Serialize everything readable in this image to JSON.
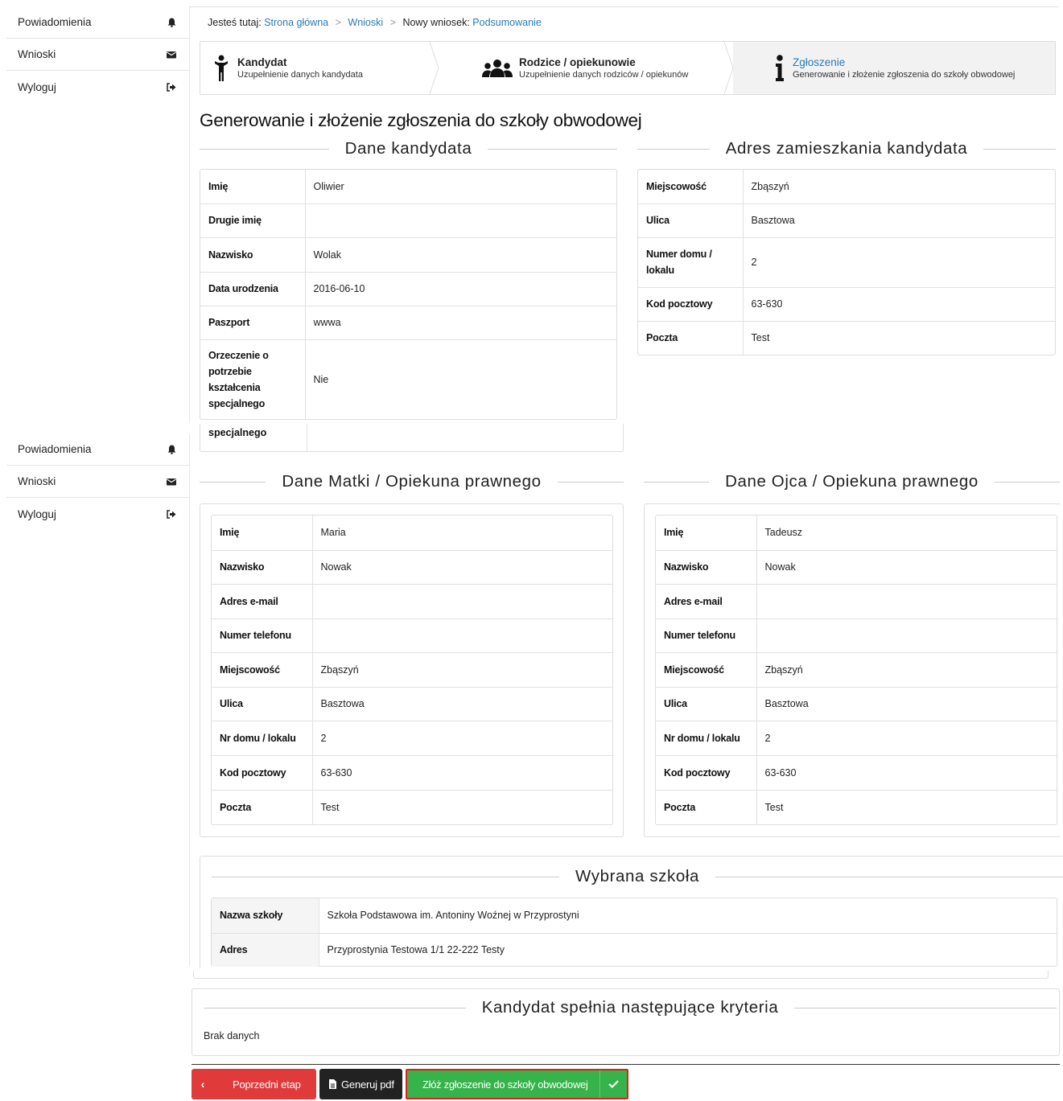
{
  "sidebar": {
    "items": [
      {
        "label": "Powiadomienia",
        "icon": "bell-icon"
      },
      {
        "label": "Wnioski",
        "icon": "envelope-icon"
      },
      {
        "label": "Wyloguj",
        "icon": "sign-out-icon"
      }
    ]
  },
  "breadcrumb": {
    "prefix": "Jesteś tutaj:",
    "home": "Strona główna",
    "section": "Wnioski",
    "current_prefix": "Nowy wniosek:",
    "current": "Podsumowanie"
  },
  "steps": [
    {
      "title": "Kandydat",
      "subtitle": "Uzupełnienie danych kandydata",
      "icon": "child-icon"
    },
    {
      "title": "Rodzice / opiekunowie",
      "subtitle": "Uzupełnienie danych rodziców / opiekunów",
      "icon": "users-icon"
    },
    {
      "title": "Zgłoszenie",
      "subtitle": "Generowanie i złożenie zgłoszenia do szkoły obwodowej",
      "icon": "info-icon"
    }
  ],
  "page_title": "Generowanie i złożenie zgłoszenia do szkoły obwodowej",
  "candidate": {
    "title": "Dane kandydata",
    "rows": [
      {
        "label": "Imię",
        "value": "Oliwier"
      },
      {
        "label": "Drugie imię",
        "value": ""
      },
      {
        "label": "Nazwisko",
        "value": "Wolak"
      },
      {
        "label": "Data urodzenia",
        "value": "2016-06-10"
      },
      {
        "label": "Paszport",
        "value": "wwwa"
      },
      {
        "label": "Orzeczenie o potrzebie kształcenia specjalnego",
        "value": "Nie"
      }
    ],
    "overflow_label": "specjalnego"
  },
  "address": {
    "title": "Adres zamieszkania kandydata",
    "rows": [
      {
        "label": "Miejscowość",
        "value": "Zbąszyń"
      },
      {
        "label": "Ulica",
        "value": "Basztowa"
      },
      {
        "label": "Numer domu / lokalu",
        "value": "2"
      },
      {
        "label": "Kod pocztowy",
        "value": "63-630"
      },
      {
        "label": "Poczta",
        "value": "Test"
      }
    ]
  },
  "mother": {
    "title": "Dane Matki / Opiekuna prawnego",
    "rows": [
      {
        "label": "Imię",
        "value": "Maria"
      },
      {
        "label": "Nazwisko",
        "value": "Nowak"
      },
      {
        "label": "Adres e-mail",
        "value": ""
      },
      {
        "label": "Numer telefonu",
        "value": ""
      },
      {
        "label": "Miejscowość",
        "value": "Zbąszyń"
      },
      {
        "label": "Ulica",
        "value": "Basztowa"
      },
      {
        "label": "Nr domu / lokalu",
        "value": "2"
      },
      {
        "label": "Kod pocztowy",
        "value": "63-630"
      },
      {
        "label": "Poczta",
        "value": "Test"
      }
    ]
  },
  "father": {
    "title": "Dane Ojca / Opiekuna prawnego",
    "rows": [
      {
        "label": "Imię",
        "value": "Tadeusz"
      },
      {
        "label": "Nazwisko",
        "value": "Nowak"
      },
      {
        "label": "Adres e-mail",
        "value": ""
      },
      {
        "label": "Numer telefonu",
        "value": ""
      },
      {
        "label": "Miejscowość",
        "value": "Zbąszyń"
      },
      {
        "label": "Ulica",
        "value": "Basztowa"
      },
      {
        "label": "Nr domu / lokalu",
        "value": "2"
      },
      {
        "label": "Kod pocztowy",
        "value": "63-630"
      },
      {
        "label": "Poczta",
        "value": "Test"
      }
    ]
  },
  "school": {
    "title": "Wybrana szkoła",
    "rows": [
      {
        "label": "Nazwa szkoły",
        "value": "Szkoła Podstawowa im. Antoniny Woźnej w Przyprostyni"
      },
      {
        "label": "Adres",
        "value": "Przyprostynia Testowa 1/1 22-222 Testy"
      }
    ]
  },
  "criteria": {
    "title": "Kandydat spełnia następujące kryteria",
    "empty_text": "Brak danych"
  },
  "buttons": {
    "prev": "Poprzedni etap",
    "pdf": "Generuj pdf",
    "submit": "Złóż zgłoszenie do szkoły obwodowej"
  },
  "colors": {
    "link": "#2a7ab8",
    "prev_button": "#e03a3a",
    "pdf_button": "#222222",
    "submit_button": "#36b34a",
    "submit_outline": "#e02020"
  }
}
